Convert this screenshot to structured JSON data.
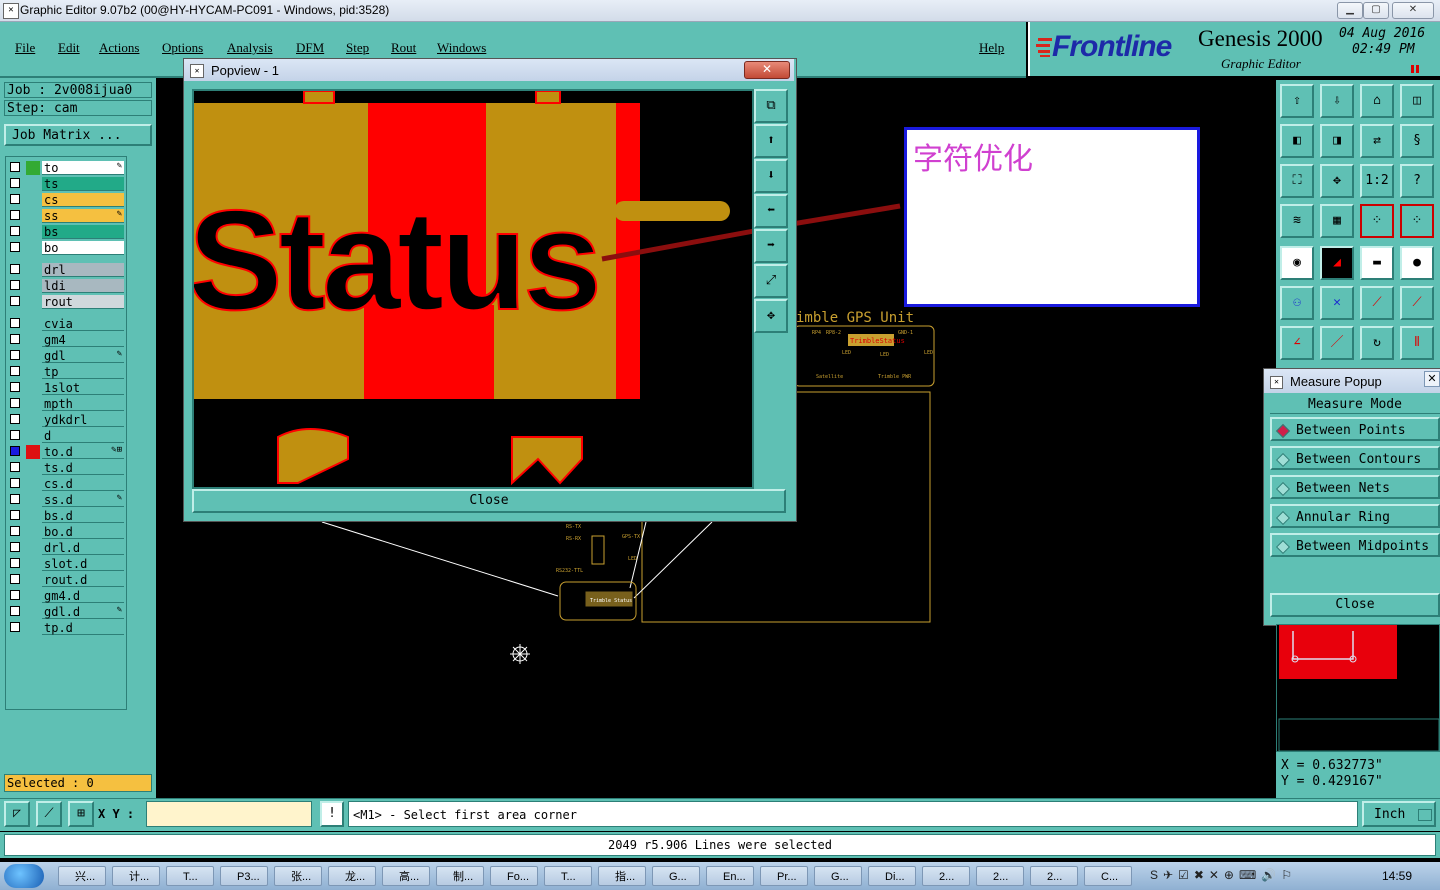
{
  "window": {
    "title": "Graphic Editor 9.07b2 (00@HY-HYCAM-PC091 - Windows, pid:3528)",
    "controls": [
      "minimize",
      "maximize",
      "close"
    ]
  },
  "menubar": {
    "items": [
      "File",
      "Edit",
      "Actions",
      "Options",
      "Analysis",
      "DFM",
      "Step",
      "Rout",
      "Windows"
    ],
    "help": "Help"
  },
  "brand": {
    "logo": "Frontline",
    "product": "Genesis 2000",
    "subtitle": "Graphic Editor",
    "date": "04 Aug 2016",
    "time": "02:49 PM"
  },
  "left_panel": {
    "job": "Job : 2v008ijua0",
    "step": "Step: cam",
    "job_matrix_button": "Job Matrix ...",
    "layers": [
      {
        "name": "to",
        "color": "#ffffff",
        "swatch": "#33aa33",
        "icon": "pencil"
      },
      {
        "name": "ts",
        "color": "#22aa88",
        "swatch": "",
        "icon": ""
      },
      {
        "name": "cs",
        "color": "#f5c040",
        "swatch": "",
        "icon": ""
      },
      {
        "name": "ss",
        "color": "#f5c040",
        "swatch": "",
        "icon": "pencil"
      },
      {
        "name": "bs",
        "color": "#22aa88",
        "swatch": "",
        "icon": ""
      },
      {
        "name": "bo",
        "color": "#ffffff",
        "swatch": "",
        "icon": ""
      },
      {
        "name": "drl",
        "color": "#a8b8c0",
        "swatch": "",
        "icon": ""
      },
      {
        "name": "ldi",
        "color": "#a8b8c0",
        "swatch": "",
        "icon": ""
      },
      {
        "name": "rout",
        "color": "#d0d8dc",
        "swatch": "",
        "icon": ""
      },
      {
        "name": "cvia",
        "color": "",
        "swatch": "",
        "icon": ""
      },
      {
        "name": "gm4",
        "color": "",
        "swatch": "",
        "icon": ""
      },
      {
        "name": "gdl",
        "color": "",
        "swatch": "",
        "icon": "pencil"
      },
      {
        "name": "tp",
        "color": "",
        "swatch": "",
        "icon": ""
      },
      {
        "name": "1slot",
        "color": "",
        "swatch": "",
        "icon": ""
      },
      {
        "name": "mpth",
        "color": "",
        "swatch": "",
        "icon": ""
      },
      {
        "name": "ydkdrl",
        "color": "",
        "swatch": "",
        "icon": ""
      },
      {
        "name": "d",
        "color": "",
        "swatch": "",
        "icon": ""
      },
      {
        "name": "to.d",
        "color": "",
        "swatch": "#dd1111",
        "icon": "pencil-grid",
        "selected": true
      },
      {
        "name": "ts.d",
        "color": "",
        "swatch": "",
        "icon": ""
      },
      {
        "name": "cs.d",
        "color": "",
        "swatch": "",
        "icon": ""
      },
      {
        "name": "ss.d",
        "color": "",
        "swatch": "",
        "icon": "pencil"
      },
      {
        "name": "bs.d",
        "color": "",
        "swatch": "",
        "icon": ""
      },
      {
        "name": "bo.d",
        "color": "",
        "swatch": "",
        "icon": ""
      },
      {
        "name": "drl.d",
        "color": "",
        "swatch": "",
        "icon": ""
      },
      {
        "name": "slot.d",
        "color": "",
        "swatch": "",
        "icon": ""
      },
      {
        "name": "rout.d",
        "color": "",
        "swatch": "",
        "icon": ""
      },
      {
        "name": "gm4.d",
        "color": "",
        "swatch": "",
        "icon": ""
      },
      {
        "name": "gdl.d",
        "color": "",
        "swatch": "",
        "icon": "pencil"
      },
      {
        "name": "tp.d",
        "color": "",
        "swatch": "",
        "icon": ""
      }
    ],
    "selected_count": "Selected : 0"
  },
  "popview": {
    "title": "Popview - 1",
    "zoom_text": "Status",
    "close_label": "Close"
  },
  "canvas": {
    "board_label": "imble GPS Unit",
    "annotation": "字符优化",
    "small_labels": [
      "Trimble Status",
      "Satellite",
      "Trimble PWR",
      "LED",
      "RS-TX",
      "RS-RX",
      "RS232-TTL",
      "GPS-TX"
    ]
  },
  "measure_popup": {
    "title": "Measure Popup",
    "mode_label": "Measure Mode",
    "options": [
      {
        "label": "Between Points",
        "selected": true
      },
      {
        "label": "Between Contours",
        "selected": false
      },
      {
        "label": "Between Nets",
        "selected": false
      },
      {
        "label": "Annular Ring",
        "selected": false
      },
      {
        "label": "Between Midpoints",
        "selected": false
      }
    ],
    "close_label": "Close"
  },
  "coords": {
    "x": "X = 0.632773\"",
    "y": "Y = 0.429167\""
  },
  "command_bar": {
    "xy_label": "X Y :",
    "xy_value": "",
    "prompt": "<M1> - Select first area corner",
    "units": "Inch"
  },
  "status": {
    "message": "2049 r5.906 Lines were selected"
  },
  "taskbar": {
    "items": [
      "兴...",
      "计...",
      "T...",
      "P3...",
      "张...",
      "龙...",
      "高...",
      "制...",
      "Fo...",
      "T...",
      "指...",
      "G...",
      "En...",
      "Pr...",
      "G...",
      "Di...",
      "2...",
      "2...",
      "2...",
      "C..."
    ],
    "clock": "14:59"
  }
}
